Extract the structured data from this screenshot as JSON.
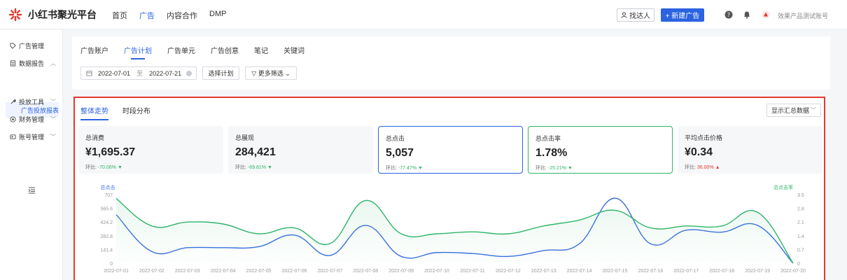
{
  "app": {
    "logo_text": "小红书聚光平台",
    "brand_color": "#e23a2e"
  },
  "topnav": [
    {
      "label": "首页",
      "active": false
    },
    {
      "label": "广告",
      "active": true
    },
    {
      "label": "内容合作",
      "active": false
    },
    {
      "label": "DMP",
      "active": false
    }
  ],
  "header": {
    "find_talent": "找达人",
    "new_ad": "+ 新建广告",
    "account": "效果产品测试账号",
    "icons": [
      "help-icon",
      "bell-icon",
      "avatar-icon"
    ]
  },
  "sidebar": {
    "items": [
      {
        "label": "广告管理",
        "icon": "tag-icon",
        "chevron": ""
      },
      {
        "label": "数据报告",
        "icon": "report-icon",
        "chevron": "^"
      },
      {
        "label": "投放工具",
        "icon": "tool-icon",
        "chevron": "v"
      },
      {
        "label": "财务管理",
        "icon": "finance-icon",
        "chevron": "v"
      },
      {
        "label": "账号管理",
        "icon": "account-icon",
        "chevron": "v"
      }
    ],
    "sub_active": "广告投放报表"
  },
  "tabs": [
    {
      "label": "广告账户",
      "active": false
    },
    {
      "label": "广告计划",
      "active": true
    },
    {
      "label": "广告单元",
      "active": false
    },
    {
      "label": "广告创意",
      "active": false
    },
    {
      "label": "笔记",
      "active": false
    },
    {
      "label": "关键词",
      "active": false
    }
  ],
  "filters": {
    "date_start": "2022-07-01",
    "date_sep": "至",
    "date_end": "2022-07-21",
    "select_plan": "选择计划",
    "more_filters": "▽ 更多筛选 ⌄"
  },
  "subtabs": [
    {
      "label": "整体走势",
      "active": true
    },
    {
      "label": "时段分布",
      "active": false
    }
  ],
  "summary_select": "显示汇总数据",
  "metrics": [
    {
      "label": "总消费",
      "value": "¥1,695.37",
      "cmp_label": "环比:",
      "cmp_value": "-70.06%",
      "trend": "down",
      "style": "plain"
    },
    {
      "label": "总展现",
      "value": "284,421",
      "cmp_label": "环比:",
      "cmp_value": "-69.81%",
      "trend": "down",
      "style": "plain"
    },
    {
      "label": "总点击",
      "value": "5,057",
      "cmp_label": "环比:",
      "cmp_value": "-77.47%",
      "trend": "down",
      "style": "sel-blue"
    },
    {
      "label": "总点击率",
      "value": "1.78%",
      "cmp_label": "环比:",
      "cmp_value": "-25.21%",
      "trend": "down",
      "style": "sel-green"
    },
    {
      "label": "平均点击价格",
      "value": "¥0.34",
      "cmp_label": "环比:",
      "cmp_value": "36.00%",
      "trend": "up",
      "style": "plain"
    }
  ],
  "chart_data": {
    "type": "line",
    "x": [
      "2022-07-01",
      "2022-07-02",
      "2022-07-03",
      "2022-07-04",
      "2022-07-05",
      "2022-07-06",
      "2022-07-07",
      "2022-07-08",
      "2022-07-09",
      "2022-07-10",
      "2022-07-11",
      "2022-07-12",
      "2022-07-13",
      "2022-07-14",
      "2022-07-15",
      "2022-07-16",
      "2022-07-17",
      "2022-07-18",
      "2022-07-19",
      "2022-07-20"
    ],
    "y_left": {
      "label": "总点击",
      "ticks": [
        "0",
        "141.4",
        "282.8",
        "424.2",
        "565.6",
        "707"
      ],
      "range": [
        0,
        707
      ],
      "color": "#3b6fe0"
    },
    "y_right": {
      "label": "总点击率",
      "ticks": [
        "0",
        "0.7",
        "1.4",
        "2.1",
        "2.8",
        "3.5"
      ],
      "range": [
        0,
        3.5
      ],
      "color": "#2fb56a"
    },
    "series": [
      {
        "name": "总点击",
        "axis": "left",
        "color": "#3b6fe0",
        "values": [
          500,
          120,
          160,
          160,
          170,
          290,
          80,
          390,
          70,
          110,
          100,
          70,
          130,
          200,
          670,
          200,
          340,
          320,
          390,
          0
        ]
      },
      {
        "name": "总点击率",
        "axis": "right",
        "color": "#2fb56a",
        "values": [
          3.3,
          1.9,
          2.1,
          2.0,
          1.5,
          1.8,
          1.0,
          3.2,
          1.5,
          1.5,
          1.6,
          1.5,
          1.9,
          2.2,
          2.7,
          1.8,
          1.9,
          1.9,
          2.6,
          0
        ]
      }
    ],
    "grid": false
  }
}
